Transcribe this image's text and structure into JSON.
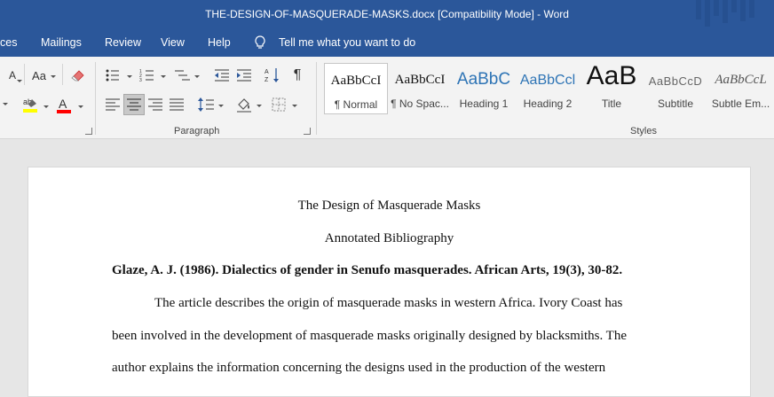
{
  "window": {
    "title": "THE-DESIGN-OF-MASQUERADE-MASKS.docx [Compatibility Mode]  -  Word"
  },
  "tabs": {
    "references_partial": "ces",
    "mailings": "Mailings",
    "review": "Review",
    "view": "View",
    "help": "Help",
    "tell_me": "Tell me what you want to do"
  },
  "ribbon": {
    "font": {
      "change_case": "Aa",
      "grow_font_partial": "A"
    },
    "paragraph": {
      "label": "Paragraph"
    },
    "styles": {
      "label": "Styles",
      "items": [
        {
          "sample": "AaBbCcI",
          "name": "¶ Normal"
        },
        {
          "sample": "AaBbCcI",
          "name": "¶ No Spac..."
        },
        {
          "sample": "AaBbC",
          "name": "Heading 1"
        },
        {
          "sample": "AaBbCcl",
          "name": "Heading 2"
        },
        {
          "sample": "AaB",
          "name": "Title"
        },
        {
          "sample": "AaBbCcD",
          "name": "Subtitle"
        },
        {
          "sample": "AaBbCcL",
          "name": "Subtle Em..."
        }
      ]
    },
    "colors": {
      "highlight": "#ffff00",
      "font_color": "#ff0000",
      "accent": "#2b579a"
    }
  },
  "document": {
    "title": "The Design of Masquerade Masks",
    "subtitle": "Annotated Bibliography",
    "citation": "Glaze, A. J. (1986). Dialectics of gender in Senufo masquerades. African Arts, 19(3), 30-82.",
    "para_line1": "The article describes the origin of masquerade masks in western Africa. Ivory Coast has",
    "para_line2": "been involved in the development of masquerade masks originally designed by blacksmiths. The",
    "para_line3": "author explains the information concerning the designs used in the production of the western"
  }
}
